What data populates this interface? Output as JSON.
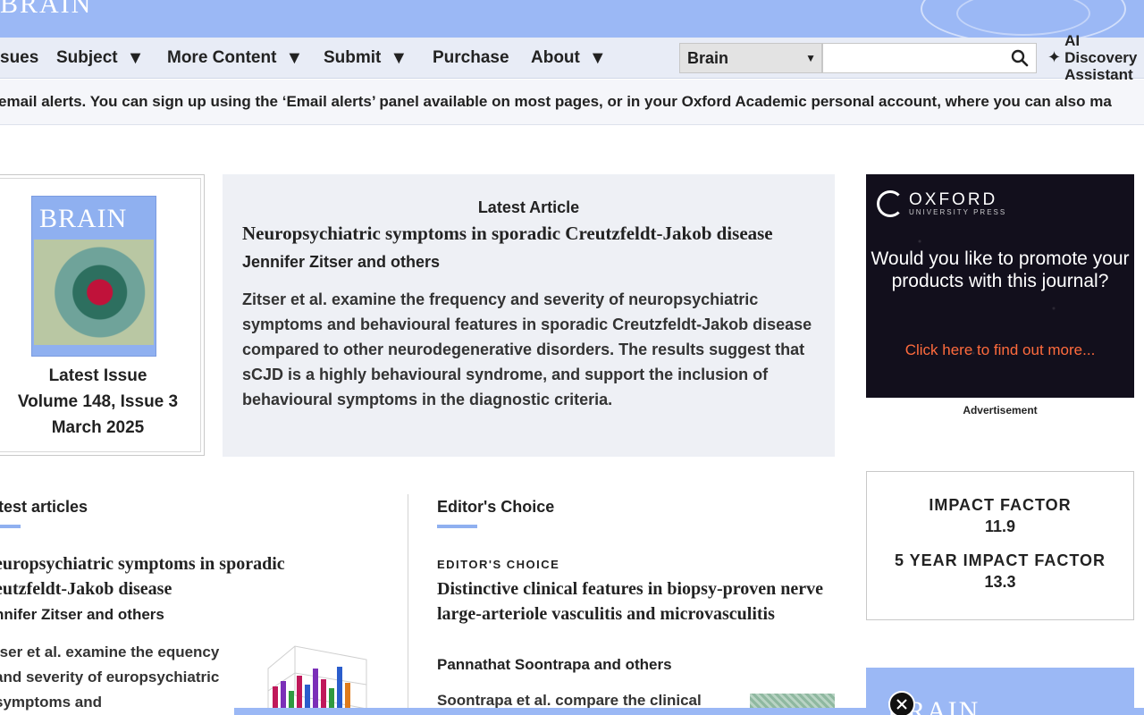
{
  "banner": {
    "logo_fragment": "BRAIN"
  },
  "nav": {
    "items": [
      {
        "label": "sues",
        "has_caret": false
      },
      {
        "label": "Subject",
        "has_caret": true
      },
      {
        "label": "More Content",
        "has_caret": true
      },
      {
        "label": "Submit",
        "has_caret": true
      },
      {
        "label": "Purchase",
        "has_caret": false
      },
      {
        "label": "About",
        "has_caret": true
      }
    ],
    "search_scope": "Brain",
    "search_value": "",
    "ai_button_label": "AI Discovery Assistant"
  },
  "alert_text": "email alerts. You can sign up using the ‘Email alerts’ panel available on most pages, or in your Oxford Academic personal account, where you can also ma",
  "latest_issue": {
    "cover_title": "BRAIN",
    "label": "Latest Issue",
    "volume": "Volume 148, Issue 3",
    "date": "March 2025"
  },
  "latest_article": {
    "heading": "Latest Article",
    "title": "Neuropsychiatric symptoms in sporadic Creutzfeldt-Jakob disease",
    "authors": "Jennifer Zitser and others",
    "abstract": "Zitser et al. examine the frequency and severity of neuropsychiatric symptoms and behavioural features in sporadic Creutzfeldt-Jakob disease compared to other neurodegenerative disorders. The results suggest that sCJD is a highly behavioural syndrome, and support the inclusion of behavioural symptoms in the diagnostic criteria."
  },
  "ad": {
    "brand": "OXFORD",
    "brand_sub": "UNIVERSITY PRESS",
    "question": "Would you like to promote your products with this journal?",
    "cta": "Click here to find out more...",
    "label": "Advertisement"
  },
  "latest_articles_section": {
    "heading": "test articles",
    "title": "europsychiatric symptoms in sporadic eutzfeldt-Jakob disease",
    "authors": "nnifer Zitser and others",
    "abstract": "tser et al. examine the equency and severity of europsychiatric symptoms and"
  },
  "editors_choice": {
    "heading": "Editor's Choice",
    "kicker": "EDITOR'S CHOICE",
    "title": "Distinctive clinical features in biopsy-proven nerve large-arteriole vasculitis and microvasculitis",
    "authors": "Pannathat Soontrapa and others",
    "abstract": "Soontrapa et al. compare the clinical"
  },
  "impact": {
    "label1": "IMPACT FACTOR",
    "value1": "11.9",
    "label2": "5 YEAR IMPACT FACTOR",
    "value2": "13.3"
  },
  "bottom_ad": {
    "text": "BRAIN"
  },
  "colors": {
    "accent": "#9bb8f5",
    "nav_bg": "#e8ecf6",
    "ad_bg": "#120f1c",
    "cta": "#ff6b3d"
  },
  "icons": {
    "search": "search-icon",
    "ai": "sparkle-icon",
    "close": "close-icon"
  }
}
